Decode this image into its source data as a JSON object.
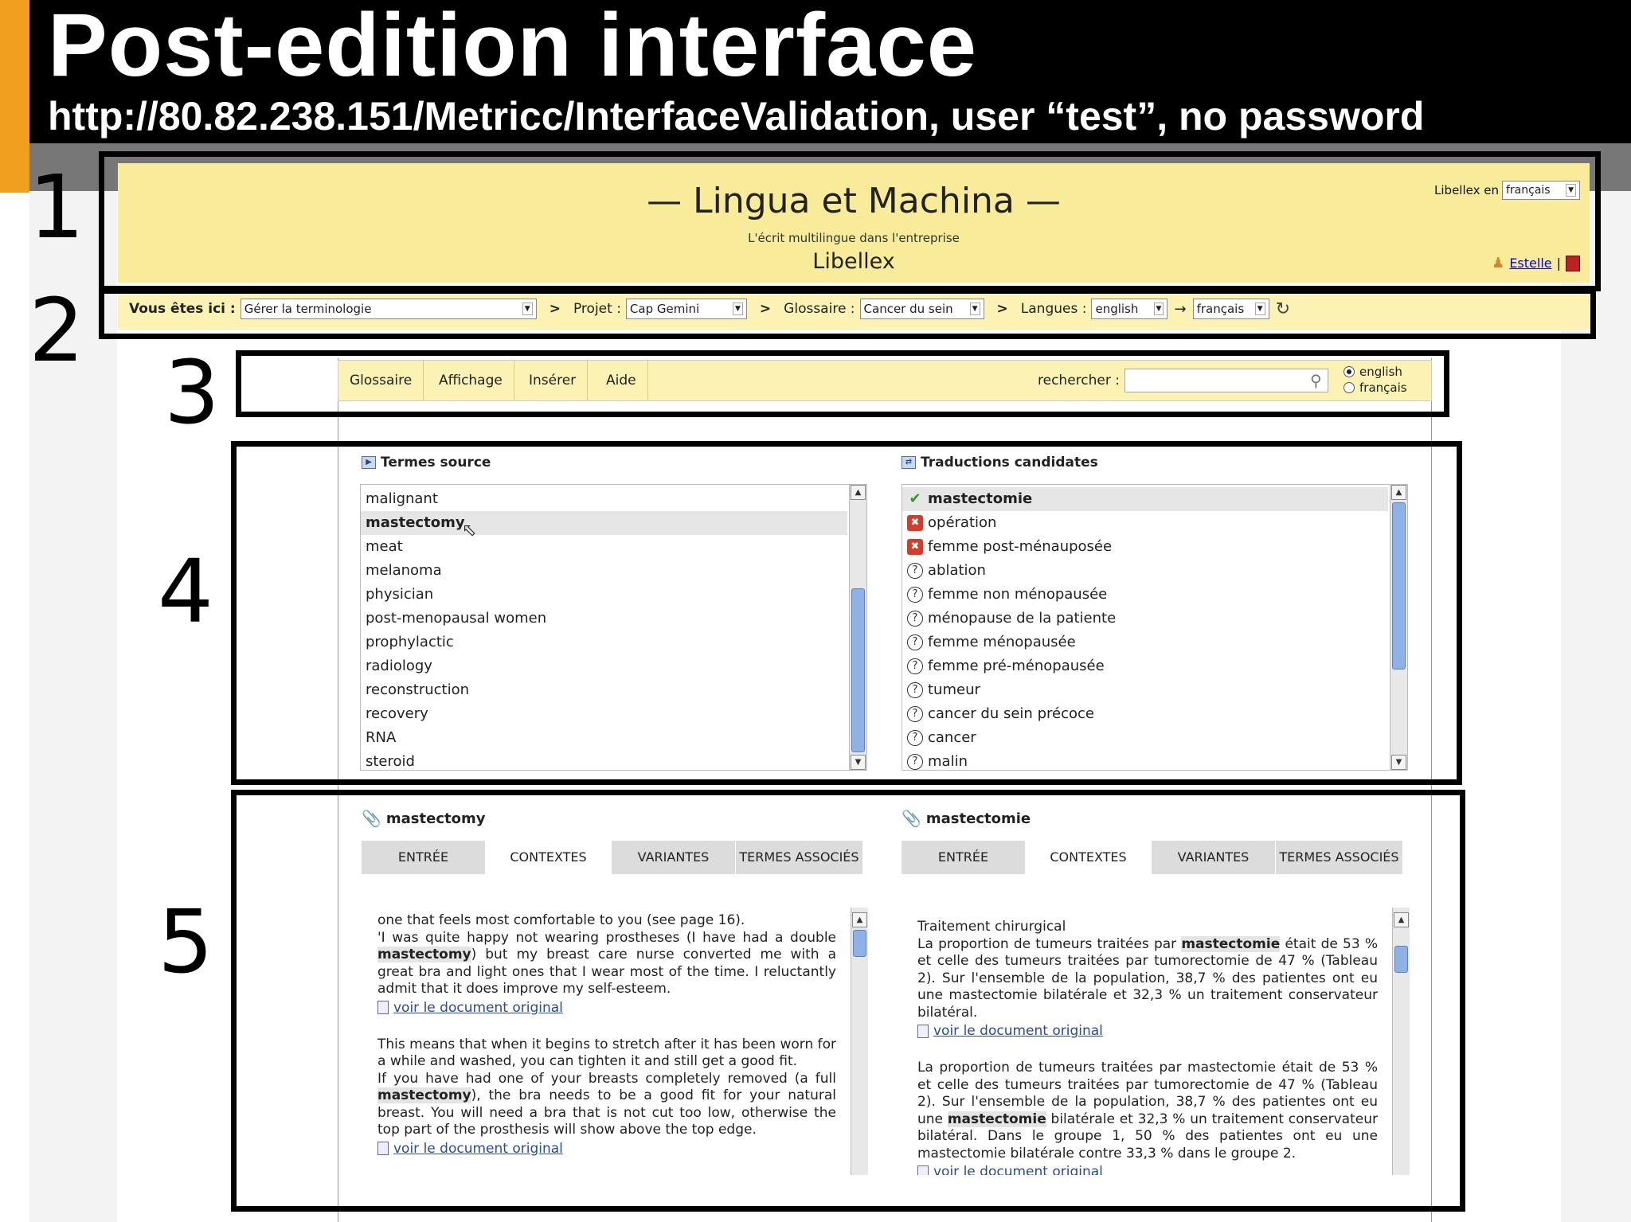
{
  "slide": {
    "title": "Post-edition interface",
    "subtitle": "http://80.82.238.151/Metricc/InterfaceValidation, user “test”,  no password",
    "region_numbers": [
      "1",
      "2",
      "3",
      "4",
      "5"
    ]
  },
  "header": {
    "app_name": "— Lingua et Machina —",
    "tagline": "L'écrit multilingue dans l'entreprise",
    "product": "Libellex",
    "ui_lang_label": "Libellex en",
    "ui_lang_value": "français",
    "user_name": "Estelle",
    "user_sep": "|"
  },
  "breadcrumb": {
    "here_label": "Vous êtes ici :",
    "here_value": "Gérer la terminologie",
    "project_label": "Projet :",
    "project_value": "Cap Gemini",
    "glossary_label": "Glossaire :",
    "glossary_value": "Cancer du sein",
    "languages_label": "Langues :",
    "source_lang": "english",
    "arrow": "→",
    "target_lang": "français",
    "separator": ">"
  },
  "menu": {
    "items": [
      "Glossaire",
      "Affichage",
      "Insérer",
      "Aide"
    ],
    "search_label": "rechercher :",
    "search_value": "",
    "lang_options": [
      "english",
      "français"
    ],
    "lang_selected": "english"
  },
  "source_terms": {
    "title": "Termes source",
    "selected": "mastectomy",
    "items": [
      "malignant",
      "mastectomy",
      "meat",
      "melanoma",
      "physician",
      "post-menopausal women",
      "prophylactic",
      "radiology",
      "reconstruction",
      "recovery",
      "RNA",
      "steroid"
    ]
  },
  "candidates": {
    "title": "Traductions candidates",
    "items": [
      {
        "label": "mastectomie",
        "status": "validated"
      },
      {
        "label": "opération",
        "status": "rejected"
      },
      {
        "label": "femme post-ménauposée",
        "status": "rejected"
      },
      {
        "label": "ablation",
        "status": "unknown"
      },
      {
        "label": "femme non ménopausée",
        "status": "unknown"
      },
      {
        "label": "ménopause de la patiente",
        "status": "unknown"
      },
      {
        "label": "femme ménopausée",
        "status": "unknown"
      },
      {
        "label": "femme pré-ménopausée",
        "status": "unknown"
      },
      {
        "label": "tumeur",
        "status": "unknown"
      },
      {
        "label": "cancer du sein précoce",
        "status": "unknown"
      },
      {
        "label": "cancer",
        "status": "unknown"
      },
      {
        "label": "malin",
        "status": "unknown"
      }
    ]
  },
  "detail_tabs": [
    "ENTRÉE",
    "CONTEXTES",
    "VARIANTES",
    "TERMES ASSOCIÉS"
  ],
  "active_tab": "CONTEXTES",
  "link_text": "voir le document original",
  "source_detail": {
    "term": "mastectomy",
    "contexts": [
      {
        "segments": [
          {
            "t": "one that feels most comfortable to you (see page 16).\n'I was quite happy not wearing prostheses (I have had a double ",
            "b": false
          },
          {
            "t": "mastectomy",
            "b": true
          },
          {
            "t": ") but my breast care nurse converted me with a great bra and light ones that I wear most of the time. I reluctantly admit that it does improve my self-esteem.",
            "b": false
          }
        ]
      },
      {
        "segments": [
          {
            "t": "This means that when it begins to stretch after it has been worn for a while and washed, you can tighten it and still get a good fit.\nIf you have had one of your breasts completely removed (a full ",
            "b": false
          },
          {
            "t": "mastectomy",
            "b": true
          },
          {
            "t": "), the bra needs to be a good fit for your natural breast. You will need a bra that is not cut too low, otherwise the top part of the prosthesis will show above the top edge.",
            "b": false
          }
        ]
      }
    ]
  },
  "target_detail": {
    "term": "mastectomie",
    "contexts": [
      {
        "segments": [
          {
            "t": "Traitement chirurgical\nLa proportion de tumeurs traitées par ",
            "b": false
          },
          {
            "t": "mastectomie",
            "b": true
          },
          {
            "t": " était de 53 % et celle des tumeurs traitées par tumorectomie de 47 % (Tableau 2). Sur l'ensemble de la population, 38,7 % des patientes ont eu une mastectomie bilatérale et 32,3 % un traitement conservateur bilatéral.",
            "b": false
          }
        ]
      },
      {
        "segments": [
          {
            "t": "La proportion de tumeurs traitées par mastectomie était de 53 % et celle des tumeurs traitées par tumorectomie de 47 % (Tableau 2). Sur l'ensemble de la population, 38,7 % des patientes ont eu une ",
            "b": false
          },
          {
            "t": "mastectomie",
            "b": true
          },
          {
            "t": " bilatérale et 32,3 % un traitement conservateur bilatéral. Dans le groupe 1, 50 % des patientes ont eu une mastectomie bilatérale contre 33,3 % dans le groupe 2.",
            "b": false
          }
        ]
      }
    ]
  },
  "colors": {
    "header_bg": "#f8ec9a",
    "toolbar_bg": "#fbf2b4",
    "accent_orange": "#f0a01e",
    "link": "#2a4a9a"
  }
}
